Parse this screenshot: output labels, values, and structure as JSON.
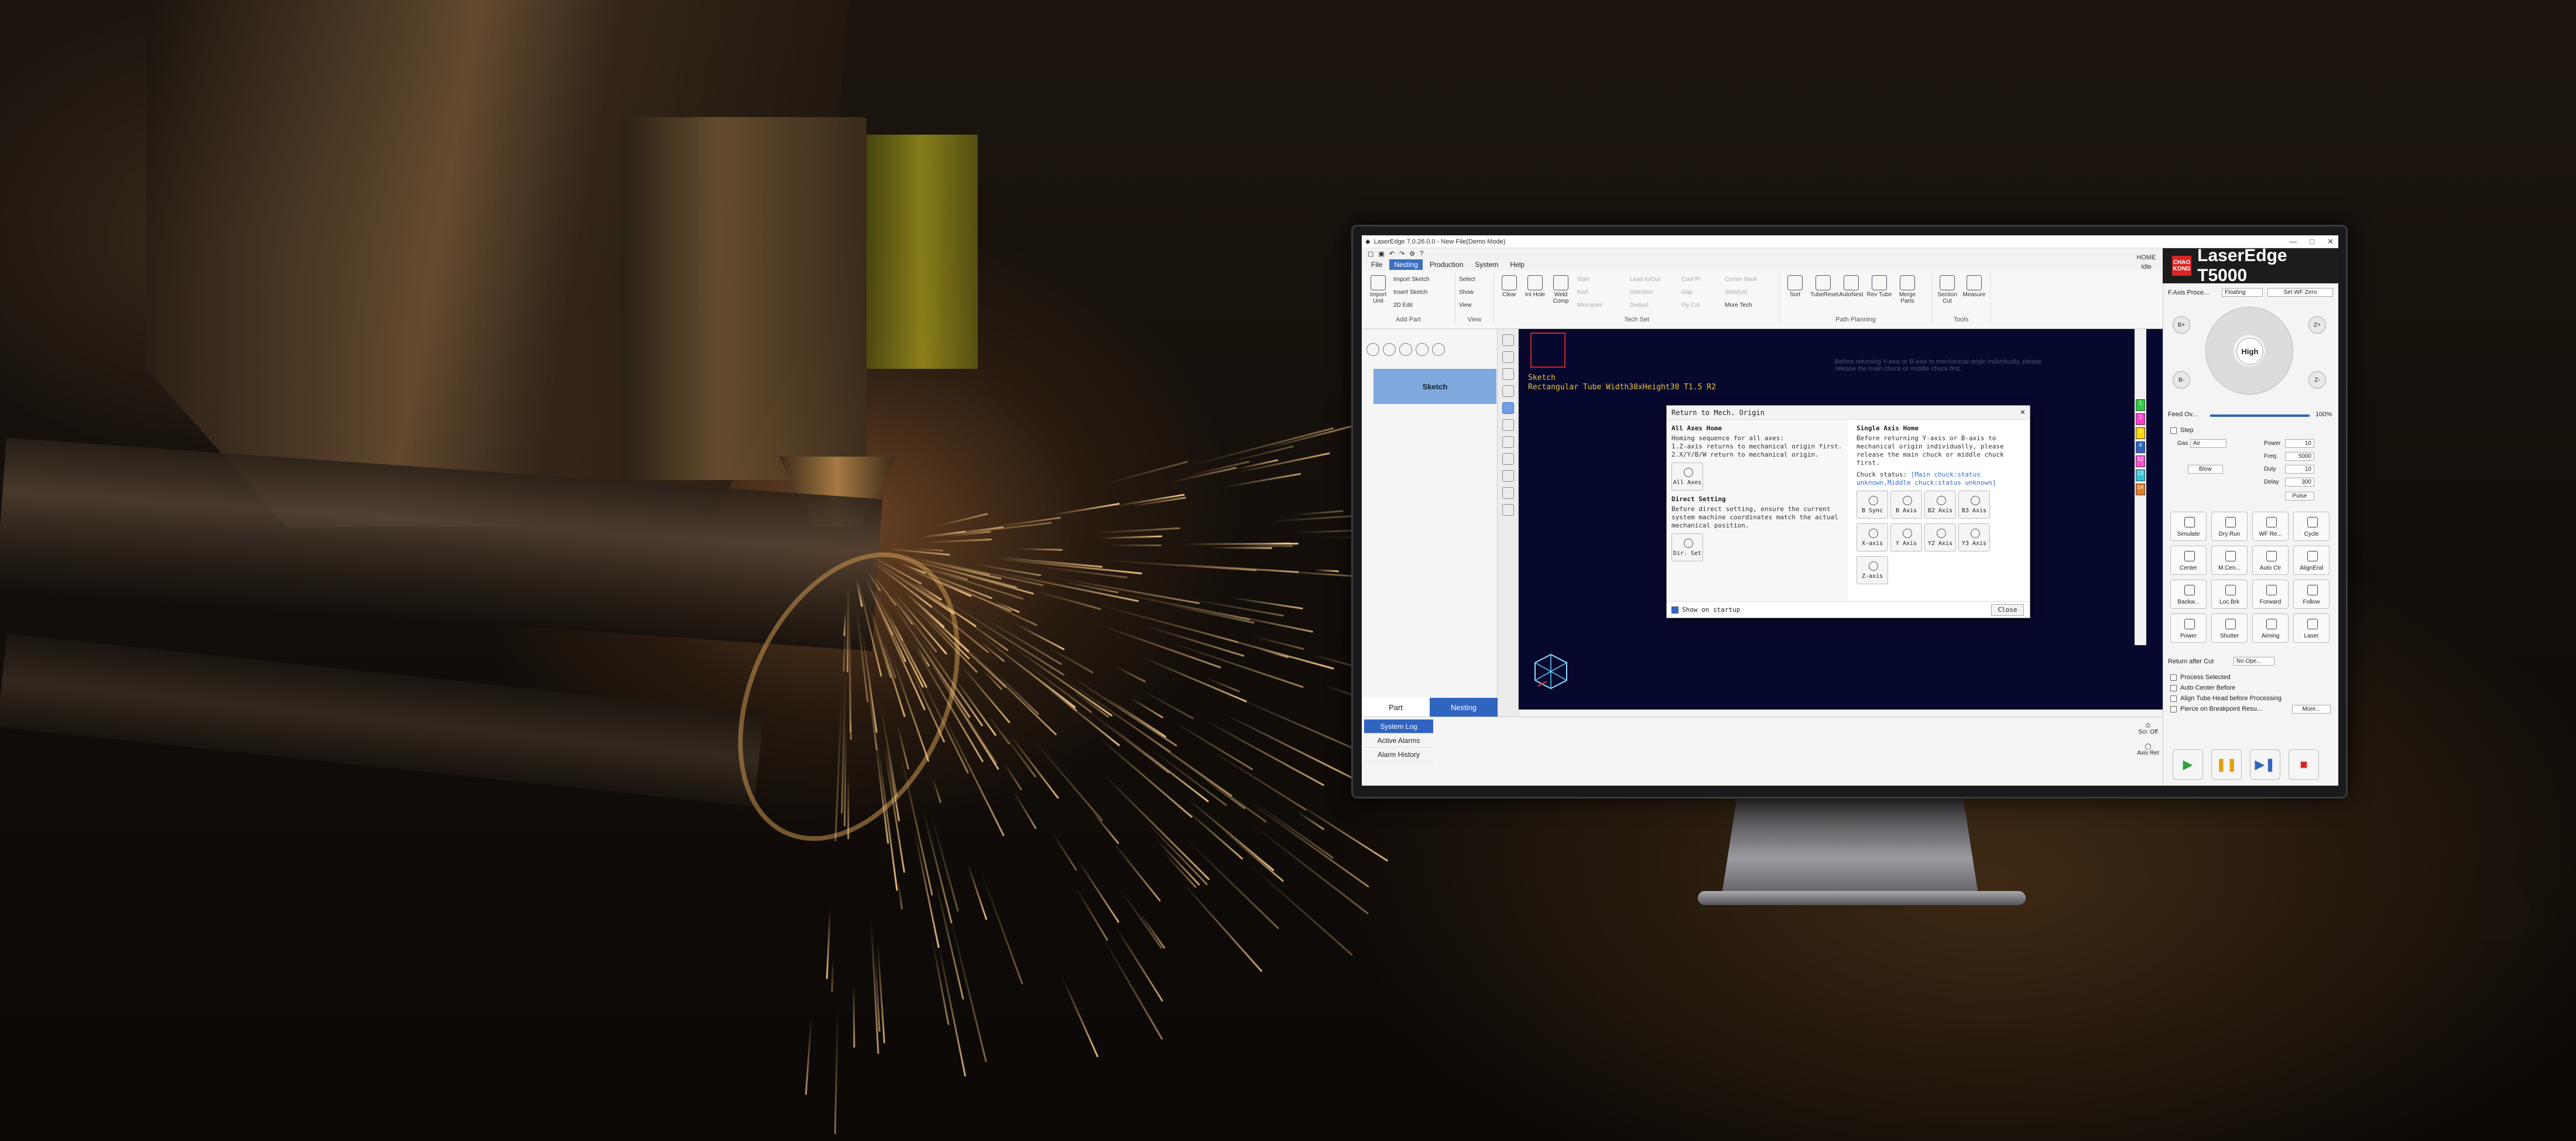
{
  "app": {
    "title": "LaserEdge 7.0.26.0.0 - New File(Demo Mode)",
    "window_controls": [
      "—",
      "□",
      "✕"
    ],
    "brand": "LaserEdge T5000",
    "logo_text": "CHAO KONG",
    "home_label": "HOME",
    "state_label": "Idle"
  },
  "menu": [
    "File",
    "Nesting",
    "Production",
    "System",
    "Help"
  ],
  "ribbon": {
    "groups": [
      "Add Part",
      "View",
      "Tech Set",
      "Path Planning",
      "Tools"
    ],
    "add_part": [
      "Import Unit",
      "Import Sketch",
      "Insert Sketch",
      "2D Edit"
    ],
    "view": [
      "Select",
      "Show",
      "View"
    ],
    "tech": [
      "Clear",
      "Int Hole",
      "Weld Comp",
      "Start",
      "Kerf",
      "Microjoint",
      "Lead In/Out",
      "Direction",
      "Deduct",
      "Cool Pt",
      "Gap",
      "Fly Cut",
      "Corner Mark",
      "Slots(UI)",
      "More Tech"
    ],
    "path": [
      "Sort",
      "TubeReset",
      "AutoNest",
      "Rev Tube",
      "Merge Parts"
    ],
    "tools": [
      "Section Cut",
      "Measure"
    ]
  },
  "left_panel": {
    "sketch_label": "Sketch",
    "tab_part": "Part",
    "tab_nesting": "Nesting"
  },
  "canvas": {
    "line1": "Sketch",
    "line2": "Rectangular Tube Width30xHeight30 T1.5 R2",
    "faint": "Before returning Y-axis or B-axis to mechanical origin individually, please release the main chuck or middle chuck first."
  },
  "dialog": {
    "title": "Return to Mech. Origin",
    "close": "✕",
    "all_axes_title": "All Axes Home",
    "all_axes_desc": "Homing sequence for all axes:\n1.Z-axis returns to mechanical origin first.\n2.X/Y/B/W return to mechanical origin.",
    "all_axes_btn": "All Axes",
    "direct_title": "Direct Setting",
    "direct_desc": "Before direct setting, ensure the current system machine coordinates match the actual mechanical position.",
    "direct_btn": "Dir. Set",
    "single_title": "Single Axis Home",
    "single_desc": "Before returning Y-axis or B-axis to mechanical origin individually, please release the main chuck or middle chuck first.",
    "chuck_status_label": "Chuck status:",
    "chuck_status_value": "[Main chuck:status unknown,Middle chuck:status unknown]",
    "axis_row1": [
      "B Sync",
      "B Axis",
      "B2 Axis",
      "B3 Axis"
    ],
    "axis_row2": [
      "X-axis",
      "Y Axis",
      "Y2 Axis",
      "Y3 Axis",
      "Z-axis"
    ],
    "show_on_startup": "Show on startup",
    "close_btn": "Close"
  },
  "log": {
    "tabs": [
      "System Log",
      "Active Alarms",
      "Alarm History"
    ],
    "btn1": "Scr. Off",
    "btn2": "Axis Ret"
  },
  "layers": [
    {
      "label": "1",
      "color": "#2ecc40"
    },
    {
      "label": "2",
      "color": "#ff3fd0"
    },
    {
      "label": "3",
      "color": "#ffd400"
    },
    {
      "label": "4",
      "color": "#2f64c0"
    },
    {
      "label": "12",
      "color": "#ff4dd2"
    },
    {
      "label": "13",
      "color": "#2ec5d6"
    },
    {
      "label": "14",
      "color": "#e67e22"
    }
  ],
  "right_panel": {
    "fpos_label": "F.Axis Proce...",
    "fpos_value": "Floating",
    "set_wf_zero": "Set WF Zero",
    "jog_center": "High",
    "feed_label": "Feed Ov...",
    "feed_value": "100%",
    "step_label": "Step",
    "gas_label": "Gas",
    "gas_value": "Air",
    "power_label": "Power",
    "power_value": "10",
    "freq_label": "Freq.",
    "freq_value": "5000",
    "duty_label": "Duty",
    "duty_value": "10",
    "delay_label": "Delay",
    "delay_value": "300",
    "blow_btn": "Blow",
    "pulse_btn": "Pulse",
    "buttons": [
      "Simulate",
      "Dry Run",
      "WF Re...",
      "Cycle",
      "Center",
      "M.Cen...",
      "Auto Ctr",
      "AlignEnd",
      "Backw...",
      "Loc.Brk",
      "Forward",
      "Follow",
      "Power",
      "Shutter",
      "Aiming",
      "Laser"
    ],
    "return_after_cut_label": "Return after Cut",
    "return_after_cut_value": "No Ope...",
    "checks": [
      "Process Selected",
      "Auto Center Before",
      "Align Tube Head before Processing",
      "Pierce on Breakpoint Resu..."
    ],
    "more_btn": "More..."
  },
  "colors": {
    "accent": "#2f64c0",
    "canvas_bg": "#07082e",
    "sketch_text": "#e8c443",
    "brand_red": "#d92525"
  }
}
